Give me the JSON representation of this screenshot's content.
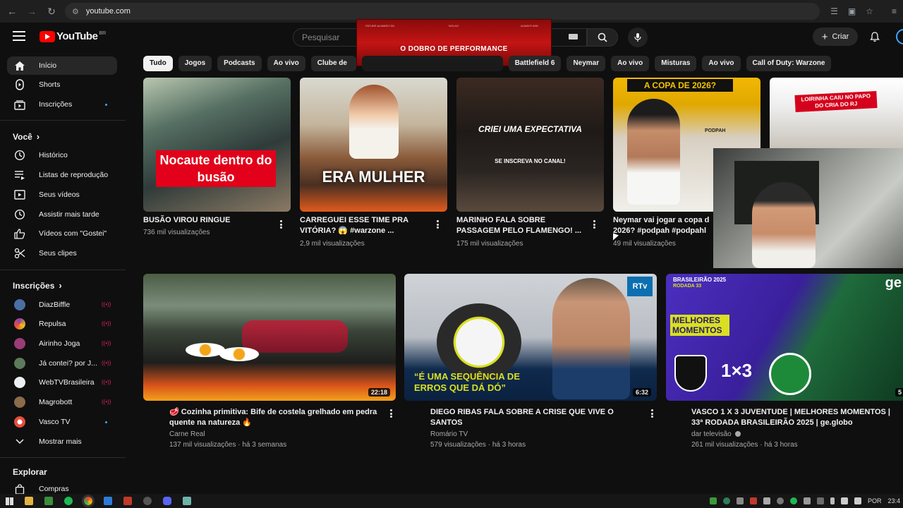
{
  "browser": {
    "url": "youtube.com"
  },
  "header": {
    "logo_text": "YouTube",
    "country_code": "BR",
    "search_placeholder": "Pesquisar",
    "create_label": "Criar"
  },
  "ad_overlay": {
    "micro_left": "FATURE ALMARIO DIL",
    "micro_center": "NOLAO",
    "micro_right": "ALWAYS WIN",
    "headline": "O DOBRO DE PERFORMANCE"
  },
  "sidebar": {
    "main": [
      {
        "label": "Início",
        "icon": "home-icon"
      },
      {
        "label": "Shorts",
        "icon": "shorts-icon"
      },
      {
        "label": "Inscrições",
        "icon": "subscriptions-icon"
      }
    ],
    "you_heading": "Você",
    "you": [
      {
        "label": "Histórico",
        "icon": "history-icon"
      },
      {
        "label": "Listas de reprodução",
        "icon": "playlists-icon"
      },
      {
        "label": "Seus vídeos",
        "icon": "your-videos-icon"
      },
      {
        "label": "Assistir mais tarde",
        "icon": "watch-later-icon"
      },
      {
        "label": "Vídeos com \"Gostei\"",
        "icon": "like-icon"
      },
      {
        "label": "Seus clipes",
        "icon": "clips-icon"
      }
    ],
    "subs_heading": "Inscrições",
    "subscriptions": [
      {
        "label": "DiazBiffle",
        "color": "#4a6fa5"
      },
      {
        "label": "Repulsa",
        "color": "#8e44ad"
      },
      {
        "label": "Airinho Joga",
        "color": "#c0392b"
      },
      {
        "label": "Já contei? por J...",
        "color": "#7f8c8d"
      },
      {
        "label": "WebTVBrasileira",
        "color": "#ecf0f1"
      },
      {
        "label": "Magrobott",
        "color": "#d35400"
      },
      {
        "label": "Vasco TV",
        "color": "#e74c3c"
      }
    ],
    "show_more": "Mostrar mais",
    "explore_heading": "Explorar",
    "explore": [
      {
        "label": "Compras",
        "icon": "shopping-icon"
      }
    ]
  },
  "chips": [
    "Tudo",
    "Jogos",
    "Podcasts",
    "Ao vivo",
    "Clube de",
    "Battlefield 6",
    "Neymar",
    "Ao vivo",
    "Misturas",
    "Ao vivo",
    "Call of Duty: Warzone"
  ],
  "row1": [
    {
      "title": "BUSÃO VIROU RINGUE",
      "views": "736 mil visualizações",
      "overlay": "Nocaute dentro do busão"
    },
    {
      "title": "CARREGUEI ESSE TIME PRA VITÓRIA? 😱 #warzone ...",
      "views": "2,9 mil visualizações",
      "overlay": "ERA MULHER"
    },
    {
      "title": "MARINHO FALA SOBRE PASSAGEM PELO FLAMENGO! ...",
      "views": "175 mil visualizações",
      "overlay": "CRIEI UMA EXPECTATIVA",
      "overlay2": "SE INSCREVA NO CANAL!"
    },
    {
      "title": "Neymar vai jogar a copa d 2026? #podpah #podpahl",
      "views": "49 mil visualizações",
      "overlay": "A COPA DE 2026?",
      "overlay2": "PODPAH"
    },
    {
      "title": "",
      "views": "",
      "overlay": "LOIRINHA CAIU NO PAPO DO CRIA DO RJ"
    }
  ],
  "row2": [
    {
      "title": "🥩 Cozinha primitiva: Bife de costela grelhado em pedra quente na natureza 🔥",
      "channel": "Carne Real",
      "meta": "137 mil visualizações · há 3 semanas",
      "duration": "22:18"
    },
    {
      "title": "DIEGO RIBAS FALA SOBRE A CRISE QUE VIVE O SANTOS",
      "channel": "Romário TV",
      "meta": "579 visualizações · há 3 horas",
      "duration": "6:32",
      "overlay": "“É UMA SEQUÊNCIA DE ERROS QUE DÁ DÓ”",
      "badge": "RTv"
    },
    {
      "title": "VASCO 1 X 3 JUVENTUDE | MELHORES MOMENTOS | 33ª RODADA BRASILEIRÃO 2025 | ge.globo",
      "channel": "dar televisão",
      "meta": "261 mil visualizações · há 3 horas",
      "duration": "5",
      "overlay_top": "BRASILEIRÃO 2025",
      "overlay_round": "RODADA 33",
      "overlay_label": "MELHORES MOMENTOS",
      "score": "1×3",
      "brand": "ge"
    }
  ],
  "taskbar": {
    "lang": "POR",
    "clock": "23:4"
  }
}
